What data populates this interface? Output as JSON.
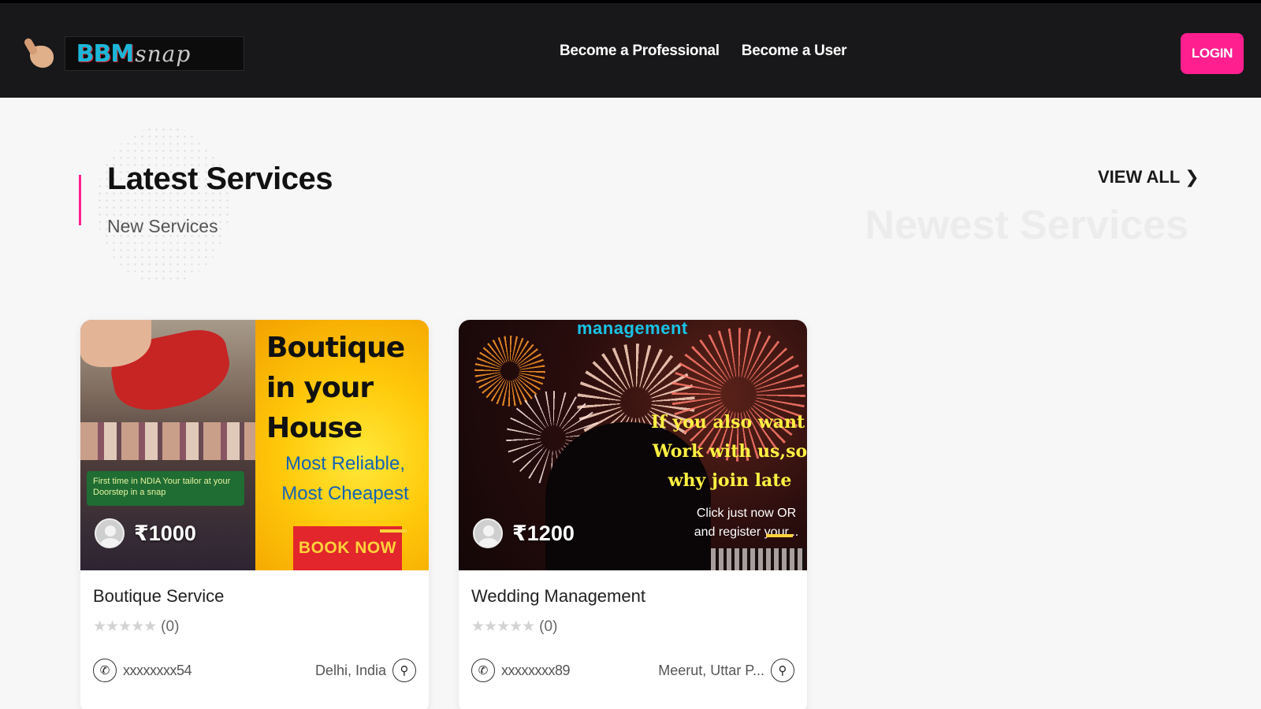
{
  "header": {
    "logo": {
      "brand": "BBM",
      "script": "snap"
    },
    "nav": [
      "Become a Professional",
      "Become a User"
    ],
    "login_label": "LOGIN"
  },
  "section": {
    "title": "Latest Services",
    "subtitle": "New Services",
    "view_all_label": "VIEW ALL",
    "watermark": "Newest Services"
  },
  "colors": {
    "accent": "#ff1f8f",
    "header_bg": "#18181a",
    "brand_cyan": "#1bb7d8"
  },
  "cards": [
    {
      "title": "Boutique Service",
      "price": "₹1000",
      "rating_count": "(0)",
      "phone": "xxxxxxxx54",
      "location": "Delhi, India",
      "image": {
        "headline": "Boutique in your House",
        "tagline": "Most Reliable, Most Cheapest",
        "cta": "BOOK NOW",
        "promo": "First time in NDIA Your tailor at your Doorstep in a snap"
      }
    },
    {
      "title": "Wedding Management",
      "price": "₹1200",
      "rating_count": "(0)",
      "phone": "xxxxxxxx89",
      "location": "Meerut, Uttar P...",
      "image": {
        "top_text": "management",
        "yellow_lines": [
          "If you also want to",
          "Work with us,so",
          "why join late"
        ],
        "white_lines": [
          "Click just now OR",
          "and register your..."
        ]
      }
    }
  ],
  "icons": {
    "phone": "phone-icon",
    "location": "map-pin-icon",
    "star": "star-icon",
    "chevron": "chevron-right-icon"
  }
}
